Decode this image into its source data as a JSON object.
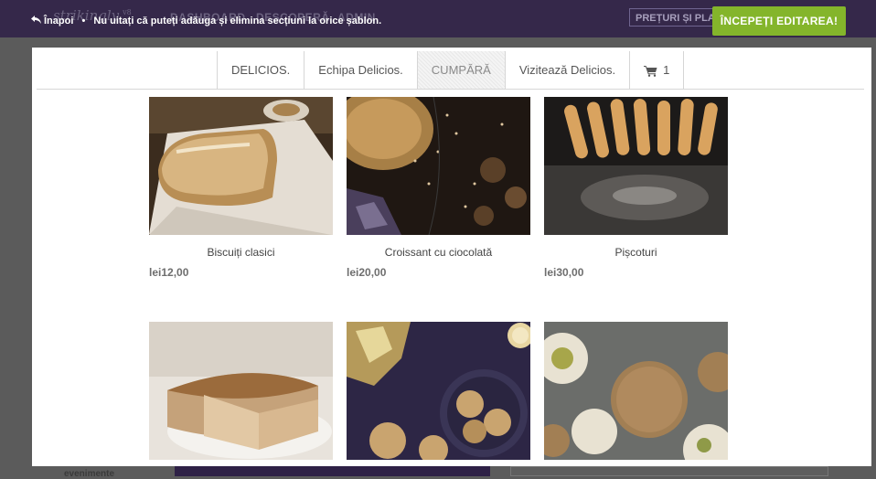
{
  "background_app": {
    "logo": "strikingly",
    "logo_suffix": "v8",
    "nav": [
      "DASHBOARD",
      "DESCOPERĂ",
      "ADMIN"
    ],
    "pricing_label": "PREȚURI ȘI PLANURI",
    "bottom_text": "evenimente"
  },
  "editor_bar": {
    "back_label": "Înapoi",
    "hint": "Nu uitați că puteți adăuga și elimina secțiuni la orice șablon.",
    "start_button": "ÎNCEPEȚI EDITAREA!"
  },
  "site_nav": {
    "items": [
      "DELICIOS.",
      "Echipa Delicios.",
      "CUMPĂRĂ",
      "Vizitează Delicios."
    ],
    "active_item": "CUMPĂRĂ",
    "cart_count": "1"
  },
  "products": [
    {
      "name": "Biscuiți clasici",
      "price": "lei12,00",
      "image": "bread-loaf-photo"
    },
    {
      "name": "Croissant cu ciocolată",
      "price": "lei20,00",
      "image": "dark-chocolate-pastry-photo"
    },
    {
      "name": "Pișcoturi",
      "price": "lei30,00",
      "image": "ladyfinger-biscuits-photo"
    },
    {
      "name": "",
      "price": "",
      "image": "cheesecake-slice-photo"
    },
    {
      "name": "",
      "price": "",
      "image": "cookies-bowl-photo"
    },
    {
      "name": "",
      "price": "",
      "image": "macarons-photo"
    }
  ],
  "colors": {
    "accent_button": "#84b52b",
    "topbar": "#35284a"
  }
}
